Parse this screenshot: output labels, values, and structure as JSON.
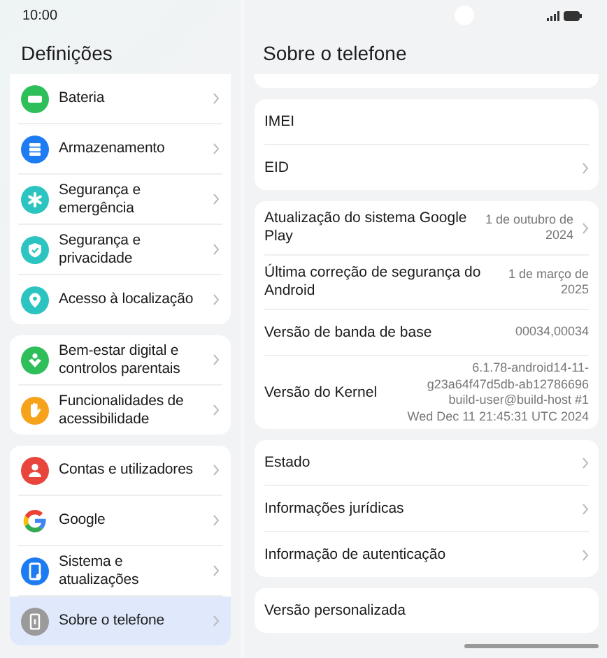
{
  "status_bar": {
    "time": "10:00"
  },
  "sidebar": {
    "title": "Definições",
    "groups": [
      {
        "partial_top": true,
        "items": [
          {
            "label": "Bateria",
            "kind": "battery",
            "color": "#2fbf5a",
            "selected": false
          },
          {
            "label": "Armazenamento",
            "kind": "storage",
            "color": "#1e7cf2",
            "selected": false
          },
          {
            "label": "Segurança e emergência",
            "kind": "asterisk",
            "color": "#2bc4c0",
            "selected": false
          },
          {
            "label": "Segurança e privacidade",
            "kind": "shield",
            "color": "#2bc4c0",
            "selected": false
          },
          {
            "label": "Acesso à localização",
            "kind": "pin",
            "color": "#2bc4c0",
            "selected": false
          }
        ]
      },
      {
        "partial_top": false,
        "items": [
          {
            "label": "Bem-estar digital e controlos parentais",
            "kind": "wellbeing",
            "color": "#2fbf5a",
            "selected": false
          },
          {
            "label": "Funcionalidades de acessibilidade",
            "kind": "hand",
            "color": "#f7a21b",
            "selected": false
          }
        ]
      },
      {
        "partial_top": false,
        "items": [
          {
            "label": "Contas e utilizadores",
            "kind": "person",
            "color": "#e8453c",
            "selected": false
          },
          {
            "label": "Google",
            "kind": "google",
            "selected": false
          },
          {
            "label": "Sistema e atualizações",
            "kind": "system",
            "color": "#1e7cf2",
            "selected": false
          },
          {
            "label": "Sobre o telefone",
            "kind": "phone",
            "color": "#9a9a9a",
            "selected": true
          }
        ]
      }
    ]
  },
  "detail": {
    "title": "Sobre o telefone",
    "groups": [
      {
        "partial_top": true
      },
      {
        "partial_top": false,
        "rows": [
          {
            "label": "IMEI",
            "chevron": false
          },
          {
            "label": "EID",
            "chevron": true
          }
        ]
      },
      {
        "partial_top": false,
        "rows": [
          {
            "label": "Atualização do sistema Google Play",
            "value_lines": [
              "1 de outubro de",
              "2024"
            ],
            "chevron": true
          },
          {
            "label": "Última correção de segurança do Android",
            "value_lines": [
              "1 de março de",
              "2025"
            ],
            "chevron": false
          },
          {
            "label": "Versão de banda de base",
            "value_lines": [
              "00034,00034"
            ],
            "chevron": false
          },
          {
            "label": "Versão do Kernel",
            "value_lines": [
              "6.1.78-android14-11-",
              "g23a64f47d5db-ab12786696",
              "build-user@build-host #1",
              "Wed Dec 11 21:45:31 UTC 2024"
            ],
            "chevron": false
          }
        ]
      },
      {
        "partial_top": false,
        "rows": [
          {
            "label": "Estado",
            "chevron": true
          },
          {
            "label": "Informações jurídicas",
            "chevron": true
          },
          {
            "label": "Informação de autenticação",
            "chevron": true
          }
        ]
      },
      {
        "partial_top": false,
        "rows": [
          {
            "label": "Versão personalizada",
            "chevron": false
          }
        ]
      }
    ]
  }
}
